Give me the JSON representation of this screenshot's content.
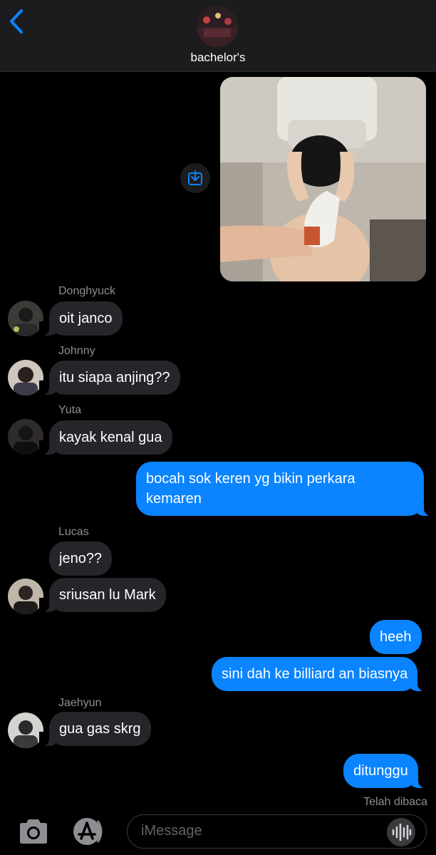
{
  "header": {
    "group_name": "bachelor's"
  },
  "messages": [
    {
      "sender": "Donghyuck",
      "text": "oit janco"
    },
    {
      "sender": "Johnny",
      "text": "itu siapa anjing??"
    },
    {
      "sender": "Yuta",
      "text": "kayak kenal gua"
    },
    {
      "sender": "me",
      "text_line1": "bocah sok keren yg bikin perkara",
      "text_line2": "kemaren"
    },
    {
      "sender": "Lucas",
      "text": "jeno??"
    },
    {
      "sender": "Lucas",
      "text": "sriusan lu Mark"
    },
    {
      "sender": "me",
      "text": "heeh"
    },
    {
      "sender": "me",
      "text": "sini dah ke billiard an biasnya"
    },
    {
      "sender": "Jaehyun",
      "text": "gua gas skrg"
    },
    {
      "sender": "me",
      "text": "ditunggu"
    }
  ],
  "read_receipt": "Telah dibaca",
  "input": {
    "placeholder": "iMessage"
  },
  "colors": {
    "outgoing": "#0a84ff",
    "incoming": "#26252a",
    "accent": "#0a84ff"
  },
  "icons": [
    "back-chevron-icon",
    "save-download-icon",
    "camera-icon",
    "app-store-icon",
    "audio-waveform-icon"
  ]
}
